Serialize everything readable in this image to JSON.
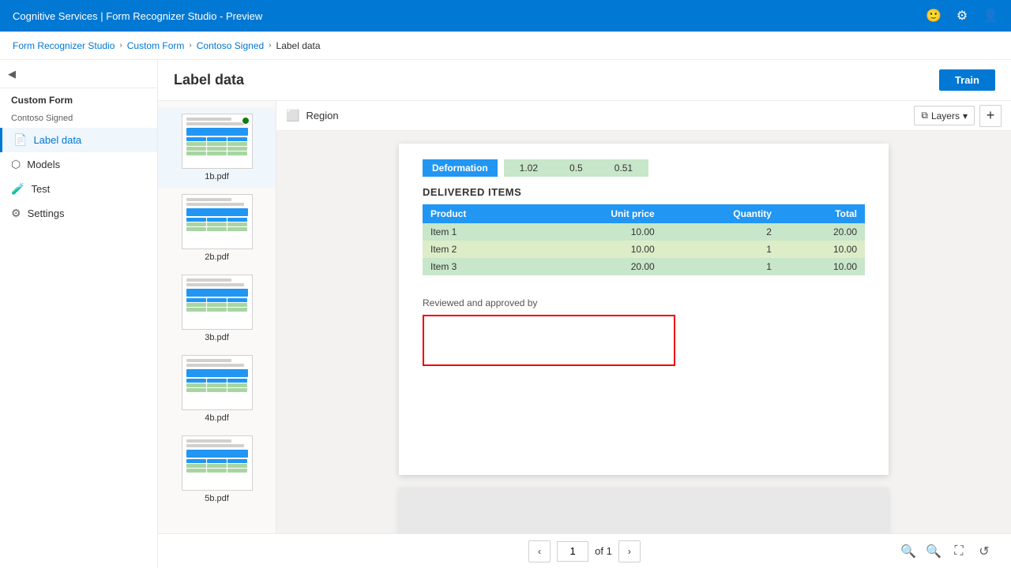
{
  "app": {
    "title": "Cognitive Services | Form Recognizer Studio - Preview"
  },
  "breadcrumb": {
    "items": [
      {
        "label": "Form Recognizer Studio",
        "current": false
      },
      {
        "label": "Custom Form",
        "current": false
      },
      {
        "label": "Contoso Signed",
        "current": false
      },
      {
        "label": "Label data",
        "current": true
      }
    ]
  },
  "sidebar": {
    "collapse_icon": "≡",
    "section_label": "Custom Form",
    "group_label": "Contoso Signed",
    "nav_items": [
      {
        "id": "label-data",
        "label": "Label data",
        "icon": "📄",
        "active": true
      },
      {
        "id": "models",
        "label": "Models",
        "icon": "⬡",
        "active": false
      },
      {
        "id": "test",
        "label": "Test",
        "icon": "🧪",
        "active": false
      },
      {
        "id": "settings",
        "label": "Settings",
        "icon": "⚙",
        "active": false
      }
    ]
  },
  "page": {
    "title": "Label data",
    "train_button": "Train"
  },
  "files": [
    {
      "name": "1b.pdf",
      "active": true,
      "has_status": true
    },
    {
      "name": "2b.pdf",
      "active": false,
      "has_status": false
    },
    {
      "name": "3b.pdf",
      "active": false,
      "has_status": false
    },
    {
      "name": "4b.pdf",
      "active": false,
      "has_status": false
    },
    {
      "name": "5b.pdf",
      "active": false,
      "has_status": false
    }
  ],
  "toolbar": {
    "region_label": "Region",
    "layers_label": "Layers",
    "add_label": "+"
  },
  "invoice": {
    "deformation_label": "Deformation",
    "deformation_values": [
      "1.02",
      "0.5",
      "0.51"
    ],
    "delivered_items_label": "DELIVERED ITEMS",
    "table_headers": [
      "Product",
      "Unit price",
      "Quantity",
      "Total"
    ],
    "table_rows": [
      {
        "product": "Item 1",
        "unit_price": "10.00",
        "quantity": "2",
        "total": "20.00"
      },
      {
        "product": "Item 2",
        "unit_price": "10.00",
        "quantity": "1",
        "total": "10.00"
      },
      {
        "product": "Item 3",
        "unit_price": "20.00",
        "quantity": "1",
        "total": "10.00"
      }
    ],
    "reviewed_label": "Reviewed and approved by"
  },
  "pagination": {
    "current_page": "1",
    "of_label": "of 1"
  },
  "colors": {
    "accent": "#0078d4",
    "table_header_bg": "#2196F3",
    "table_cell_bg": "#c8e6c9",
    "signature_border": "#cc0000"
  }
}
